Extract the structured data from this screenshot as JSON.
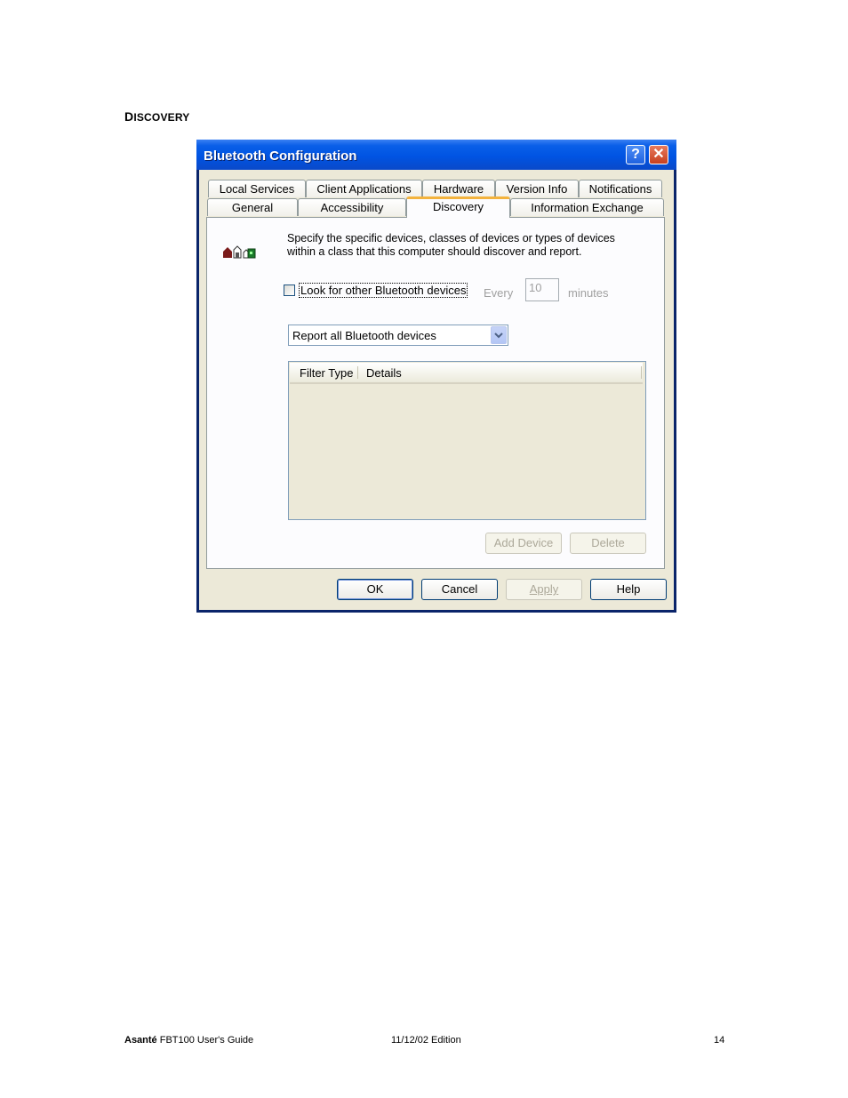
{
  "heading": {
    "first": "D",
    "rest": "ISCOVERY"
  },
  "dialog": {
    "title": "Bluetooth Configuration",
    "title_buttons": {
      "help": "?",
      "close": "✕"
    },
    "tabs_row1": [
      "Local Services",
      "Client Applications",
      "Hardware",
      "Version Info",
      "Notifications"
    ],
    "tabs_row2": [
      "General",
      "Accessibility",
      "Discovery",
      "Information Exchange"
    ],
    "active_tab": "Discovery",
    "description": "Specify the specific devices, classes of devices or types of devices within a class that this computer should discover and report.",
    "icon": "discovery-devices-icon",
    "look_for_label": "Look for other Bluetooth devices",
    "look_for_checked": false,
    "every_label": "Every",
    "minutes_value": "10",
    "minutes_label": "minutes",
    "report_select": "Report all Bluetooth devices",
    "list_columns": [
      "Filter Type",
      "Details"
    ],
    "add_device": "Add Device",
    "delete": "Delete",
    "buttons": {
      "ok": "OK",
      "cancel": "Cancel",
      "apply": "Apply",
      "help": "Help"
    }
  },
  "footer": {
    "brand": "Asanté",
    "guide": "FBT100 User's Guide",
    "edition": "11/12/02 Edition",
    "page": "14"
  }
}
